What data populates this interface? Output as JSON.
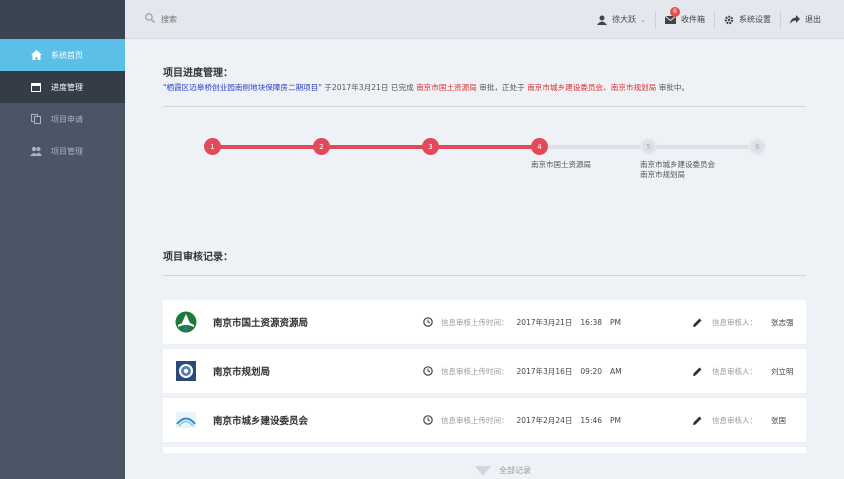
{
  "sidebar": {
    "items": [
      {
        "label": "系统首页",
        "icon": "home-icon"
      },
      {
        "label": "进度管理",
        "icon": "calendar-icon"
      },
      {
        "label": "项目申请",
        "icon": "copy-icon"
      },
      {
        "label": "项目管理",
        "icon": "users-icon"
      }
    ]
  },
  "header": {
    "search_placeholder": "搜索",
    "user_name": "徐大跃",
    "inbox_label": "收件箱",
    "inbox_count": "6",
    "settings_label": "系统设置",
    "logout_label": "退出"
  },
  "progress_section": {
    "title": "项目进度管理：",
    "desc": {
      "project": "\"栖霞区迈皋桥创业园南侧地块保障房二期项目\"",
      "text1": " 于2017年3月21日 已完成 ",
      "dept_done": "南京市国土资源局",
      "text2": " 审批，正处于 ",
      "dept_pending": "南京市城乡建设委员会、南京市规划局",
      "text3": " 审批中。"
    },
    "steps": [
      {
        "num": "1",
        "done": true
      },
      {
        "num": "2",
        "done": true
      },
      {
        "num": "3",
        "done": true
      },
      {
        "num": "4",
        "done": true,
        "label": "南京市国土资源局"
      },
      {
        "num": "5",
        "done": false,
        "label": "南京市城乡建设委员会",
        "label2": "南京市规划局"
      },
      {
        "num": "6",
        "done": false
      }
    ]
  },
  "records_section": {
    "title": "项目审核记录：",
    "time_label": "信息审核上传时间：",
    "reviewer_label": "信息审核人：",
    "records": [
      {
        "name": "南京市国土资源资源局",
        "date": "2017年3月21日",
        "time": "16:38",
        "ampm": "PM",
        "reviewer": "张志强",
        "logo": "land-resources-logo"
      },
      {
        "name": "南京市规划局",
        "date": "2017年3月16日",
        "time": "09:20",
        "ampm": "AM",
        "reviewer": "刘立明",
        "logo": "planning-bureau-logo"
      },
      {
        "name": "南京市城乡建设委员会",
        "date": "2017年2月24日",
        "time": "15:46",
        "ampm": "PM",
        "reviewer": "张国",
        "logo": "construction-committee-logo"
      }
    ],
    "more_label": "全部记录"
  },
  "colors": {
    "accent": "#5bc0e8",
    "progress_done": "#e04a5a",
    "sidebar_bg": "#4a5566"
  }
}
